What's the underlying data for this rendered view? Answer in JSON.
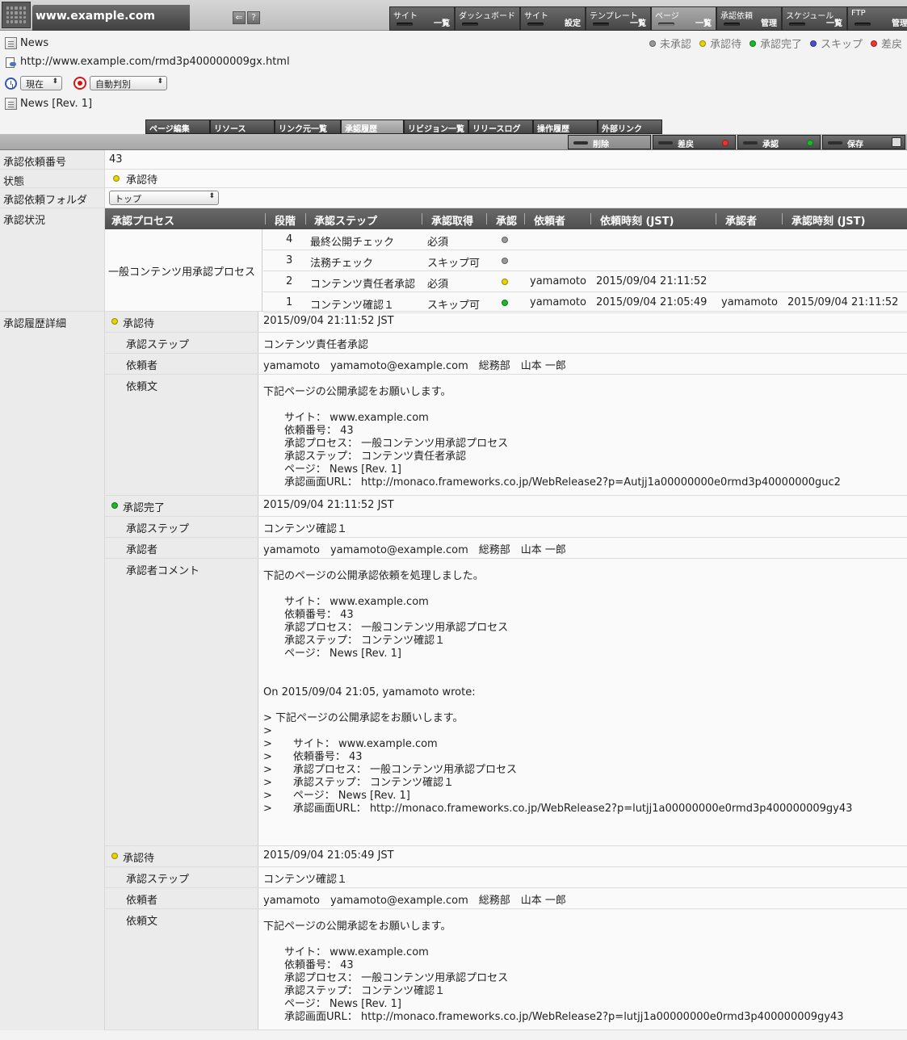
{
  "header": {
    "site": "www.example.com",
    "icon_back": "⇐",
    "icon_help": "?"
  },
  "menu": [
    {
      "l1": "サイト",
      "l2": "一覧"
    },
    {
      "l1": "ダッシュボード",
      "l2": ""
    },
    {
      "l1": "サイト",
      "l2": "設定"
    },
    {
      "l1": "テンプレート",
      "l2": "一覧"
    },
    {
      "l1": "ページ",
      "l2": "一覧"
    },
    {
      "l1": "承認依頼",
      "l2": "管理"
    },
    {
      "l1": "スケジュール",
      "l2": "一覧"
    },
    {
      "l1": "FTP",
      "l2": "管理"
    }
  ],
  "page": {
    "name": "News",
    "url": "http://www.example.com/rmd3p400000009gx.html",
    "time_select": "現在",
    "judge_select": "自動判別",
    "revision": "News [Rev. 1]"
  },
  "legend": [
    "未承認",
    "承認待",
    "承認完了",
    "スキップ",
    "差戻"
  ],
  "tabs": [
    "ページ編集",
    "リソース",
    "リンク元一覧",
    "承認履歴",
    "リビジョン一覧",
    "リリースログ",
    "操作履歴",
    "外部リンク"
  ],
  "actions": {
    "delete": "削除",
    "reject": "差戻",
    "approve": "承認",
    "save": "保存"
  },
  "fields": {
    "num_label": "承認依頼番号",
    "num": "43",
    "state_label": "状態",
    "state": "承認待",
    "folder_label": "承認依頼フォルダ",
    "folder": "トップ",
    "status_label": "承認状況",
    "detail_label": "承認履歴詳細"
  },
  "status_table": {
    "headers": [
      "承認プロセス",
      "段階",
      "承認ステップ",
      "承認取得",
      "承認",
      "依頼者",
      "依頼時刻 (JST)",
      "承認者",
      "承認時刻 (JST)"
    ],
    "process": "一般コンテンツ用承認プロセス",
    "rows": [
      {
        "stage": "4",
        "step": "最終公開チェック",
        "req": "必須",
        "requester": "",
        "req_time": "",
        "approver": "",
        "appr_time": ""
      },
      {
        "stage": "3",
        "step": "法務チェック",
        "req": "スキップ可",
        "requester": "",
        "req_time": "",
        "approver": "",
        "appr_time": ""
      },
      {
        "stage": "2",
        "step": "コンテンツ責任者承認",
        "req": "必須",
        "requester": "yamamoto",
        "req_time": "2015/09/04 21:11:52",
        "approver": "",
        "appr_time": ""
      },
      {
        "stage": "1",
        "step": "コンテンツ確認１",
        "req": "スキップ可",
        "requester": "yamamoto",
        "req_time": "2015/09/04 21:05:49",
        "approver": "yamamoto",
        "appr_time": "2015/09/04 21:11:52"
      }
    ]
  },
  "history": [
    {
      "status": "承認待",
      "time": "2015/09/04 21:11:52 JST",
      "step_label": "承認ステップ",
      "step": "コンテンツ責任者承認",
      "person_label": "依頼者",
      "person": "yamamoto　yamamoto@example.com　総務部　山本 一郎",
      "text_label": "依頼文",
      "text": "下記ページの公開承認をお願いします。\n\n　　サイト： www.example.com\n　　依頼番号： 43\n　　承認プロセス： 一般コンテンツ用承認プロセス\n　　承認ステップ： コンテンツ責任者承認\n　　ページ： News [Rev. 1]\n　　承認画面URL： http://monaco.frameworks.co.jp/WebRelease2?p=Autjj1a00000000e0rmd3p40000000guc2"
    },
    {
      "status": "承認完了",
      "time": "2015/09/04 21:11:52 JST",
      "step_label": "承認ステップ",
      "step": "コンテンツ確認１",
      "person_label": "承認者",
      "person": "yamamoto　yamamoto@example.com　総務部　山本 一郎",
      "text_label": "承認者コメント",
      "text": "下記のページの公開承認依頼を処理しました。\n\n　　サイト： www.example.com\n　　依頼番号： 43\n　　承認プロセス： 一般コンテンツ用承認プロセス\n　　承認ステップ： コンテンツ確認１\n　　ページ： News [Rev. 1]\n\n\nOn 2015/09/04 21:05, yamamoto wrote:\n\n> 下記ページの公開承認をお願いします。\n>\n>　　サイト： www.example.com\n>　　依頼番号： 43\n>　　承認プロセス： 一般コンテンツ用承認プロセス\n>　　承認ステップ： コンテンツ確認１\n>　　ページ： News [Rev. 1]\n>　　承認画面URL： http://monaco.frameworks.co.jp/WebRelease2?p=lutjj1a00000000e0rmd3p400000009gy43"
    },
    {
      "status": "承認待",
      "time": "2015/09/04 21:05:49 JST",
      "step_label": "承認ステップ",
      "step": "コンテンツ確認１",
      "person_label": "依頼者",
      "person": "yamamoto　yamamoto@example.com　総務部　山本 一郎",
      "text_label": "依頼文",
      "text": "下記ページの公開承認をお願いします。\n\n　　サイト： www.example.com\n　　依頼番号： 43\n　　承認プロセス： 一般コンテンツ用承認プロセス\n　　承認ステップ： コンテンツ確認１\n　　ページ： News [Rev. 1]\n　　承認画面URL： http://monaco.frameworks.co.jp/WebRelease2?p=lutjj1a00000000e0rmd3p400000009gy43"
    }
  ],
  "colors": {
    "pending": "#e8d400",
    "done": "#1ab82a",
    "unapproved": "#999999",
    "skip": "#4b4fc8",
    "reject": "#ee3333"
  }
}
